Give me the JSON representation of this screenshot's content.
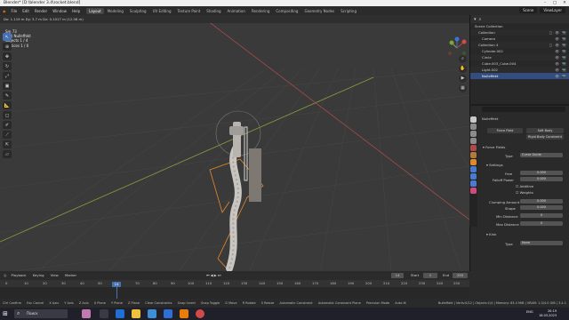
{
  "window": {
    "title": "Blender* [D:\\blender 3.4\\rocket.blend]"
  },
  "menu": {
    "items": [
      "File",
      "Edit",
      "Render",
      "Window",
      "Help"
    ],
    "workspaces": [
      "Layout",
      "Modeling",
      "Sculpting",
      "UV Editing",
      "Texture Paint",
      "Shading",
      "Animation",
      "Rendering",
      "Compositing",
      "Geometry Nodes",
      "Scripting"
    ],
    "active_workspace": "Layout",
    "scene": "Scene",
    "view_layer": "ViewLayer"
  },
  "viewport": {
    "header_text": "Dx: 1.119 m   Dy: 3.7 m   Dz: 0.1017 m (12.06 m)",
    "overlay": [
      "Sm 73",
      "(14) Nulleffekt",
      "Objects   1 / 4",
      "Vertices   1 / 0"
    ]
  },
  "outliner": {
    "title": "Scene Collection",
    "rows": [
      {
        "label": "Collection",
        "sel": false
      },
      {
        "label": "Camera",
        "sel": false
      },
      {
        "label": "Collection 4",
        "sel": false
      },
      {
        "label": "Cylinder.002",
        "sel": false
      },
      {
        "label": "Circle",
        "sel": false
      },
      {
        "label": "Cube.003_Cube.004",
        "sel": false
      },
      {
        "label": "Light.002",
        "sel": false
      },
      {
        "label": "Nulleffekt",
        "sel": true
      }
    ]
  },
  "properties": {
    "object_name": "Nulleffekt",
    "buttons": [
      "Force Field",
      "Soft Body",
      "Rigid Body Constraint"
    ],
    "section_force": "Force Fields",
    "type_label": "Type",
    "type_value": "Curve Guide",
    "section_settings": "Settings",
    "fields": [
      {
        "label": "Free",
        "value": "0.000"
      },
      {
        "label": "Falloff Power",
        "value": "0.000"
      }
    ],
    "checks": [
      "Additive",
      "Weights"
    ],
    "fields2": [
      {
        "label": "Clumping Amount",
        "value": "0.000"
      },
      {
        "label": "Shape",
        "value": "0.000"
      },
      {
        "label": "Min Distance",
        "value": "0"
      },
      {
        "label": "Max Distance",
        "value": "0"
      }
    ],
    "section_kink": "Kink",
    "kink_type_label": "Type",
    "kink_type_value": "None"
  },
  "timeline": {
    "menu": [
      "Playback",
      "Keying",
      "View",
      "Marker"
    ],
    "current_frame": "14",
    "start_label": "Start",
    "start": "1",
    "end_label": "End",
    "end": "250",
    "ticks": [
      "0",
      "10",
      "20",
      "30",
      "40",
      "50",
      "60",
      "70",
      "80",
      "90",
      "100",
      "110",
      "120",
      "130",
      "140",
      "150",
      "160",
      "170",
      "180",
      "190",
      "200",
      "210",
      "220",
      "230",
      "240",
      "250"
    ]
  },
  "statusbar": {
    "items": [
      "Ctrl Confirm",
      "Esc Cancel",
      "X Axis",
      "Y Axis",
      "Z Axis",
      "X Plane",
      "Y Plane",
      "Z Plane",
      "Clear Constraints",
      "Snap Invert",
      "Snap Toggle",
      "G Move",
      "R Rotate",
      "S Resize",
      "Automatic Constraint",
      "Automatic Constraint Plane",
      "Precision Mode",
      "Auto IK"
    ],
    "right": "Nulleffekt | Verts:0/12 | Objects:1/4 | Memory: 63.4 MiB | VRAM: 1.0/4.0 GiB | 3.4.1"
  },
  "taskbar": {
    "search": "Поиск",
    "lang": "ENG",
    "time": "20:19",
    "date": "18.03.2023"
  },
  "colors": {
    "accent": "#4772b3",
    "viewport_bg": "#3a3a3a",
    "x_axis": "#a54b4b",
    "y_axis": "#8aa03a"
  }
}
